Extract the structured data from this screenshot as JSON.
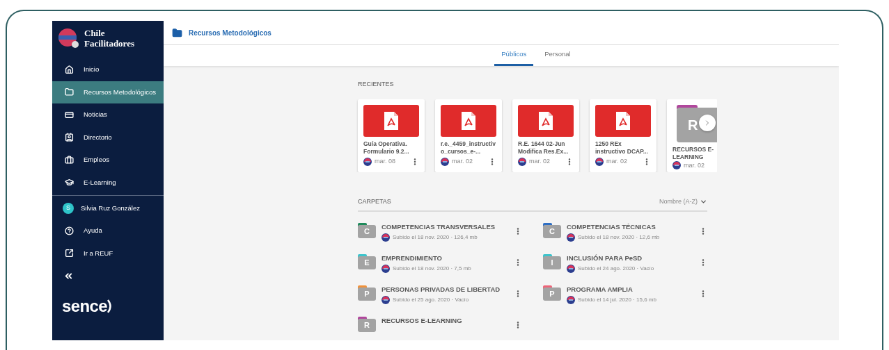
{
  "sidebar": {
    "logo": {
      "line1": "Chile",
      "line2": "Facilitadores"
    },
    "items": [
      {
        "kind": "home",
        "label": "Inicio",
        "selected": false
      },
      {
        "kind": "folder",
        "label": "Recursos Metodológicos",
        "selected": true
      },
      {
        "kind": "card",
        "label": "Noticias",
        "selected": false
      },
      {
        "kind": "contact",
        "label": "Directorio",
        "selected": false
      },
      {
        "kind": "briefcase",
        "label": "Empleos",
        "selected": false
      },
      {
        "kind": "cap",
        "label": "E-Learning",
        "selected": false
      }
    ],
    "user": {
      "initial": "S",
      "name": "Silvia Ruz González"
    },
    "links": [
      {
        "kind": "help",
        "label": "Ayuda"
      },
      {
        "kind": "external",
        "label": "Ir a REUF"
      }
    ],
    "brand": "sence"
  },
  "header": {
    "title": "Recursos Metodológicos"
  },
  "tabs": [
    {
      "label": "Públicos",
      "selected": true
    },
    {
      "label": "Personal",
      "selected": false
    }
  ],
  "recent": {
    "heading": "RECIENTES",
    "items": [
      {
        "kind": "pdf",
        "title": "Guía Operativa. Formulario 9.2...",
        "date": "mar. 08"
      },
      {
        "kind": "pdf",
        "title": "r.e._4459_instructivo_cursos_e-...",
        "date": "mar. 02"
      },
      {
        "kind": "pdf",
        "title": "R.E. 1644 02-Jun Modifica Res.Ex...",
        "date": "mar. 02"
      },
      {
        "kind": "pdf",
        "title": "1250 REx instructivo DCAP...",
        "date": "mar. 02"
      },
      {
        "kind": "folder",
        "letter": "R",
        "color": "#b0479c",
        "title": "RECURSOS E-LEARNING",
        "date": "mar. 02"
      }
    ]
  },
  "folders": {
    "heading": "CARPETAS",
    "sort": "Nombre (A-Z)",
    "items": [
      {
        "name": "COMPETENCIAS TRANSVERSALES",
        "letter": "C",
        "color": "#1f8a5b",
        "meta": "Subido el 18 nov. 2020 · 126,4 mb"
      },
      {
        "name": "COMPETENCIAS TÉCNICAS",
        "letter": "C",
        "color": "#2f6fc4",
        "meta": "Subido el 18 nov. 2020 · 12,6 mb"
      },
      {
        "name": "EMPRENDIMIENTO",
        "letter": "E",
        "color": "#3cc4cc",
        "meta": "Subido el 18 nov. 2020 · 7,5 mb"
      },
      {
        "name": "INCLUSIÓN PARA PeSD",
        "letter": "I",
        "color": "#3cc4cc",
        "meta": "Subido el 24 ago. 2020 · Vacío"
      },
      {
        "name": "PERSONAS PRIVADAS DE LIBERTAD",
        "letter": "P",
        "color": "#f0913a",
        "meta": "Subido el 25 ago. 2020 · Vacío"
      },
      {
        "name": "PROGRAMA AMPLIA",
        "letter": "P",
        "color": "#ee6478",
        "meta": "Subido el 14 jul. 2020 · 15,6 mb"
      },
      {
        "name": "RECURSOS E-LEARNING",
        "letter": "R",
        "color": "#b0479c"
      }
    ]
  }
}
